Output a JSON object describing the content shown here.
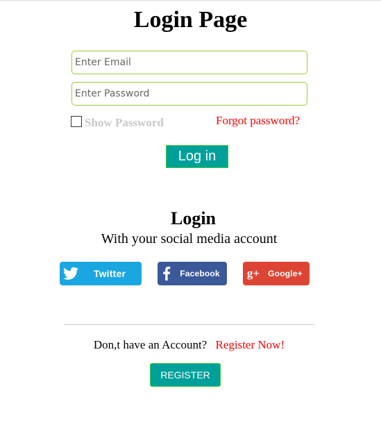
{
  "page": {
    "title": "Login Page"
  },
  "form": {
    "email_placeholder": "Enter Email",
    "password_placeholder": "Enter Password",
    "show_password_label": "Show Password",
    "forgot_password_link": "Forgot password?",
    "login_button": "Log in"
  },
  "social": {
    "title": "Login",
    "subtitle": "With your social media account",
    "buttons": [
      {
        "label": "Twitter",
        "icon": "twitter-bird-icon",
        "color": "#1aa7e1"
      },
      {
        "label": "Facebook",
        "icon": "facebook-f-icon",
        "color": "#3b5999"
      },
      {
        "label": "Google+",
        "icon": "google-plus-icon",
        "color": "#dc4533"
      }
    ]
  },
  "register": {
    "prompt": "Don,t have an Account?",
    "link": "Register Now!",
    "button": "REGISTER"
  },
  "colors": {
    "accent": "#00a09a",
    "field_border": "#9acd32",
    "link_red": "#ff0000"
  }
}
